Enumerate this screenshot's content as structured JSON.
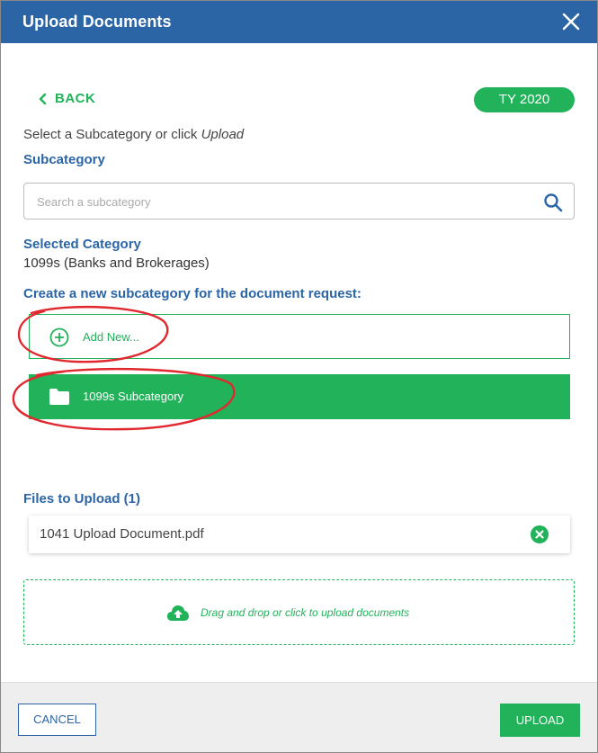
{
  "dialog": {
    "title": "Upload Documents"
  },
  "nav": {
    "back_label": "BACK",
    "tax_year_badge": "TY 2020"
  },
  "instruction": {
    "prefix": "Select a Subcategory or click ",
    "emphasis": "Upload"
  },
  "subcategory": {
    "label": "Subcategory",
    "search_placeholder": "Search a subcategory",
    "search_value": ""
  },
  "selected_category": {
    "label": "Selected Category",
    "value": "1099s (Banks and Brokerages)"
  },
  "create_new": {
    "label": "Create a new subcategory for the document request:",
    "add_new_label": "Add New...",
    "items": [
      {
        "label": "1099s Subcategory"
      }
    ]
  },
  "files": {
    "label": "Files to Upload (1)",
    "items": [
      {
        "name": "1041 Upload Document.pdf"
      }
    ]
  },
  "dropzone": {
    "text": "Drag and drop or click to upload documents"
  },
  "footer": {
    "cancel_label": "CANCEL",
    "upload_label": "UPLOAD"
  },
  "colors": {
    "header_blue": "#2b65a6",
    "accent_green": "#22b35a",
    "annotation_red": "#e0282e"
  },
  "icons": {
    "close": "close-icon",
    "back": "chevron-left-icon",
    "search": "search-icon",
    "add": "plus-circle-icon",
    "folder": "folder-icon",
    "remove": "close-circle-icon",
    "upload": "cloud-upload-icon"
  }
}
